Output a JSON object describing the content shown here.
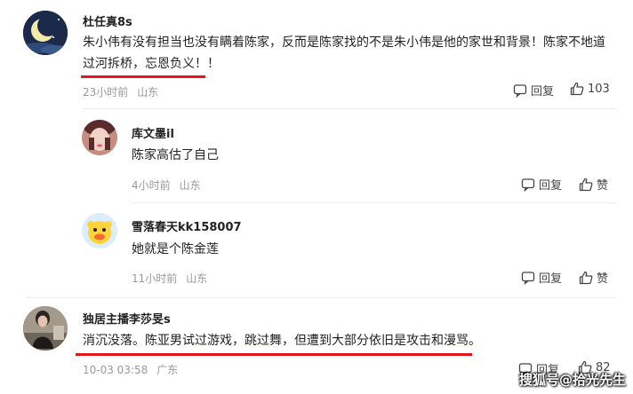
{
  "comments": [
    {
      "username": "杜任真8s",
      "text_line1": "朱小伟有没有担当也没有瞒着陈家，反而是陈家找的不是朱小伟是他的家世和背景！陈家不地道",
      "text_line2": "过河拆桥，忘恩负义！！",
      "time": "23小时前",
      "location": "山东",
      "reply_label": "回复",
      "like_count": "103"
    },
    {
      "username": "库文墨il",
      "text": "陈家高估了自己",
      "time": "4小时前",
      "location": "山东",
      "reply_label": "回复",
      "like_label": "赞"
    },
    {
      "username": "雪落春天kk158007",
      "text": "她就是个陈金莲",
      "time": "11小时前",
      "location": "山东",
      "reply_label": "回复",
      "like_label": "赞"
    },
    {
      "username": "独居主播李莎旻s",
      "text": "消沉没落。陈亚男试过游戏，跳过舞，但遭到大部分依旧是攻击和漫骂。",
      "time": "10-03 03:58",
      "location": "广东",
      "reply_label": "回复",
      "like_count": "82"
    }
  ],
  "watermark": "搜狐号@拾光先生",
  "colors": {
    "underline": "#e8141b",
    "meta": "#999999"
  },
  "icons": {
    "reply": "comment-bubble-icon",
    "like": "thumbs-up-icon"
  }
}
